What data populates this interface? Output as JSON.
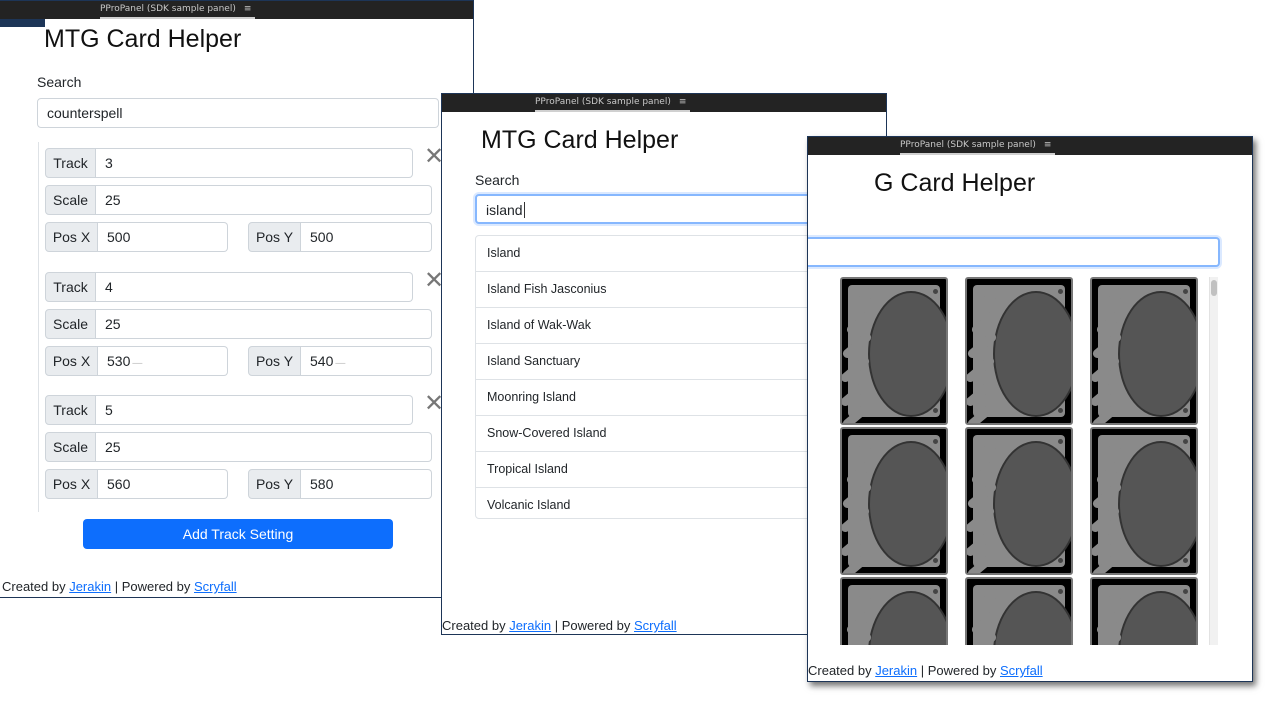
{
  "panel_title": "PProPanel (SDK sample panel)",
  "menu_icon": "≡",
  "app_title": "MTG Card Helper",
  "search_label": "Search",
  "footer": {
    "created_by": "Created by ",
    "author": "Jerakin",
    "separator": " | Powered by ",
    "powered": "Scryfall"
  },
  "panel1": {
    "search_value": "counterspell",
    "labels": {
      "track": "Track",
      "scale": "Scale",
      "posx": "Pos X",
      "posy": "Pos Y"
    },
    "tracks": [
      {
        "track": "3",
        "scale": "25",
        "posx": "500",
        "posy": "500"
      },
      {
        "track": "4",
        "scale": "25",
        "posx": "530",
        "posy": "540"
      },
      {
        "track": "5",
        "scale": "25",
        "posx": "560",
        "posy": "580"
      }
    ],
    "close_icon": "✕",
    "add_button": "Add Track Setting"
  },
  "panel2": {
    "search_value": "island",
    "results": [
      "Island",
      "Island Fish Jasconius",
      "Island of Wak-Wak",
      "Island Sanctuary",
      "Moonring Island",
      "Snow-Covered Island",
      "Tropical Island",
      "Volcanic Island"
    ],
    "result_icon": "cards-icon"
  },
  "panel3": {
    "title_visible": "G Card Helper",
    "grid_image_icon": "card-placeholder-image"
  },
  "colors": {
    "primary": "#0d6efd",
    "titlebar": "#232323",
    "focus": "#86b7fe"
  }
}
